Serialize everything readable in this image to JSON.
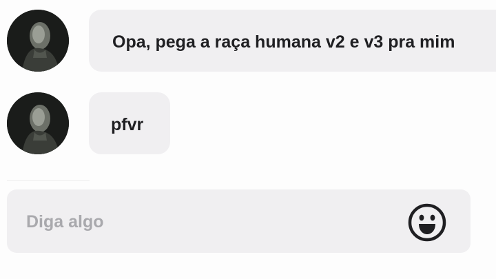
{
  "messages": [
    {
      "text": "Opa, pega a raça humana v2 e v3 pra mim",
      "avatar": "user-avatar"
    },
    {
      "text": "pfvr",
      "avatar": "user-avatar"
    }
  ],
  "composer": {
    "placeholder": "Diga algo",
    "value": "",
    "emoji_icon": "smiley-face-icon"
  },
  "colors": {
    "background": "#fdfdfd",
    "bubble": "#f0eff1",
    "text": "#1f1f22",
    "placeholder": "#a9a9ad"
  }
}
